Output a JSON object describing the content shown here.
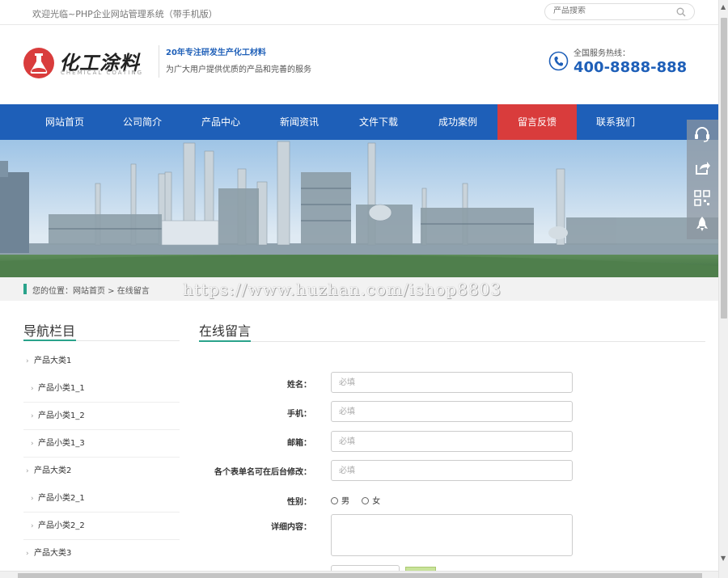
{
  "topbar": {
    "welcome": "欢迎光临~PHP企业网站管理系统（带手机版）",
    "search_placeholder": "产品搜索"
  },
  "header": {
    "logo_cn": "化工涂料",
    "logo_en": "CHEMICAL COATING",
    "slogan_title": "20年专注研发生产化工材料",
    "slogan_sub": "为广大用户提供优质的产品和完善的服务",
    "hotline_label": "全国服务热线：",
    "hotline_number": "400-8888-888"
  },
  "nav": {
    "items": [
      "网站首页",
      "公司简介",
      "产品中心",
      "新闻资讯",
      "文件下载",
      "成功案例",
      "留言反馈",
      "联系我们"
    ],
    "active": "留言反馈"
  },
  "breadcrumb": {
    "text": "您的位置：网站首页 > 在线留言",
    "watermark": "https://www.huzhan.com/ishop8803"
  },
  "sidebar": {
    "title": "导航栏目",
    "items": [
      "产品大类1",
      "产品小类1_1",
      "产品小类1_2",
      "产品小类1_3",
      "产品大类2",
      "产品小类2_1",
      "产品小类2_2",
      "产品大类3"
    ]
  },
  "form": {
    "title": "在线留言",
    "name_label": "姓名：",
    "name_placeholder": "必填",
    "phone_label": "手机：",
    "phone_placeholder": "必填",
    "email_label": "邮箱：",
    "email_placeholder": "必填",
    "custom_label": "各个表单名可在后台修改：",
    "custom_placeholder": "必填",
    "gender_label": "性别：",
    "gender_male": "男",
    "gender_female": "女",
    "detail_label": "详细内容："
  },
  "floating_toolbar": {
    "icons": [
      "headset-icon",
      "share-icon",
      "qrcode-icon",
      "rocket-icon"
    ]
  },
  "colors": {
    "nav_blue": "#1e5fb8",
    "nav_active_red": "#d93c3c",
    "accent_green": "#2aa38b"
  }
}
